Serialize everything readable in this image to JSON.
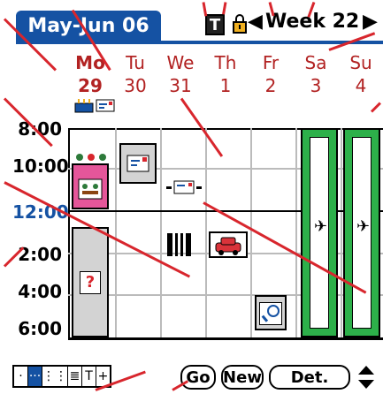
{
  "header": {
    "tab_label": "May-Jun 06",
    "t_button": "T",
    "week_label": "Week 22",
    "prev_symbol": "◀",
    "next_symbol": "▶"
  },
  "days": [
    {
      "name": "Mo",
      "num": "29"
    },
    {
      "name": "Tu",
      "num": "30"
    },
    {
      "name": "We",
      "num": "31"
    },
    {
      "name": "Th",
      "num": "1"
    },
    {
      "name": "Fr",
      "num": "2"
    },
    {
      "name": "Sa",
      "num": "3"
    },
    {
      "name": "Su",
      "num": "4"
    }
  ],
  "hours": [
    "8:00",
    "10:00",
    "12:00",
    "2:00",
    "4:00",
    "6:00"
  ],
  "toolbar": {
    "view_buttons": [
      "·",
      "···",
      "⋮⋮",
      "≣",
      "T",
      "+"
    ],
    "go": "Go",
    "new": "New",
    "details": "Det."
  },
  "colors": {
    "accent": "#1552a3",
    "day_text": "#b22222",
    "noon": "#1552a3",
    "trip": "#2db04a",
    "arrow": "#d8262d",
    "pink": "#e5569a",
    "car": "#d9333a"
  }
}
